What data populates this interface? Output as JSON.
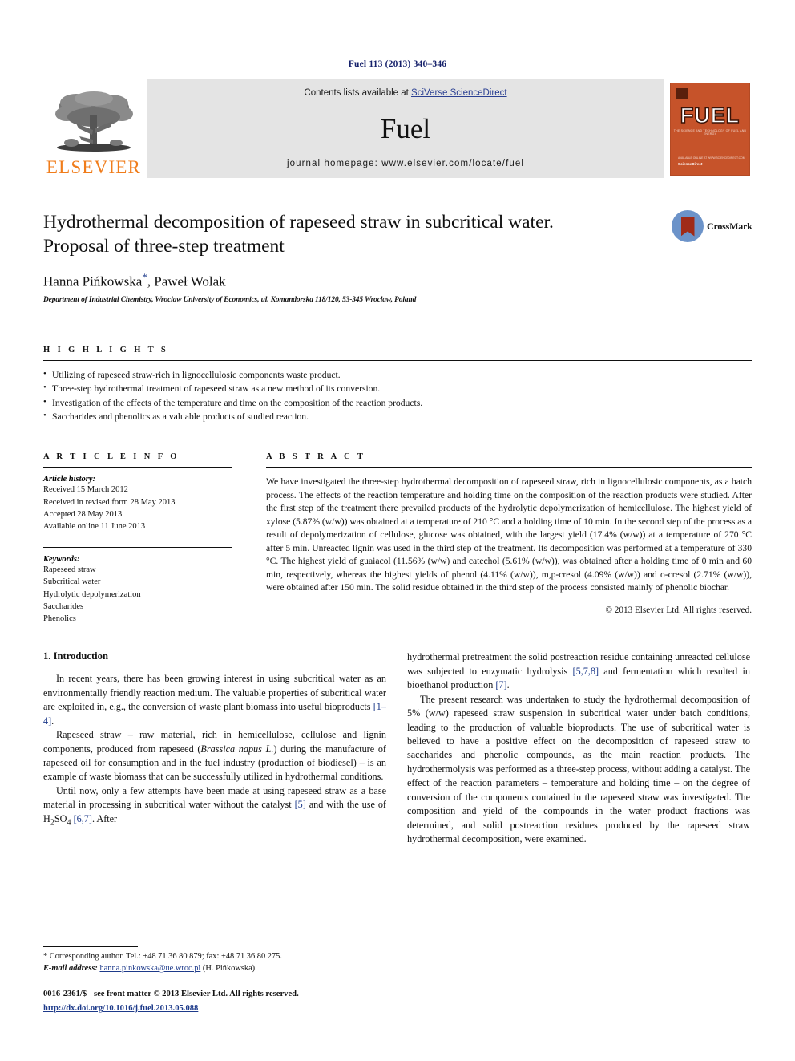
{
  "running_head": "Fuel 113 (2013) 340–346",
  "masthead": {
    "publisher_word": "ELSEVIER",
    "contents_prefix": "Contents lists available at ",
    "contents_link": "SciVerse ScienceDirect",
    "journal_name": "Fuel",
    "homepage": "journal homepage: www.elsevier.com/locate/fuel",
    "cover": {
      "title": "FUEL",
      "subtitle": "THE SCIENCE AND TECHNOLOGY OF FUEL AND ENERGY",
      "footer_small": "AVAILABLE ONLINE AT WWW.SCIENCEDIRECT.COM",
      "footer_brand": "ScienceDirect"
    }
  },
  "article": {
    "title": "Hydrothermal decomposition of rapeseed straw in subcritical water. Proposal of three-step treatment",
    "title_line1": "Hydrothermal decomposition of rapeseed straw in subcritical water.",
    "title_line2": "Proposal of three-step treatment",
    "authors": "Hanna Pińkowska",
    "corresponding_marker": "*",
    "authors_rest": ", Paweł Wolak",
    "affiliation": "Department of Industrial Chemistry, Wroclaw University of Economics, ul. Komandorska 118/120, 53-345 Wroclaw, Poland",
    "crossmark_label": "CrossMark"
  },
  "highlights": {
    "heading": "H I G H L I G H T S",
    "items": [
      "Utilizing of rapeseed straw-rich in lignocellulosic components waste product.",
      "Three-step hydrothermal treatment of rapeseed straw as a new method of its conversion.",
      "Investigation of the effects of the temperature and time on the composition of the reaction products.",
      "Saccharides and phenolics as a valuable products of studied reaction."
    ]
  },
  "article_info": {
    "heading": "A R T I C L E   I N F O",
    "history_label": "Article history:",
    "history": [
      "Received 15 March 2012",
      "Received in revised form 28 May 2013",
      "Accepted 28 May 2013",
      "Available online 11 June 2013"
    ],
    "keywords_label": "Keywords:",
    "keywords": [
      "Rapeseed straw",
      "Subcritical water",
      "Hydrolytic depolymerization",
      "Saccharides",
      "Phenolics"
    ]
  },
  "abstract": {
    "heading": "A B S T R A C T",
    "text": "We have investigated the three-step hydrothermal decomposition of rapeseed straw, rich in lignocellulosic components, as a batch process. The effects of the reaction temperature and holding time on the composition of the reaction products were studied. After the first step of the treatment there prevailed products of the hydrolytic depolymerization of hemicellulose. The highest yield of xylose (5.87% (w/w)) was obtained at a temperature of 210 °C and a holding time of 10 min. In the second step of the process as a result of depolymerization of cellulose, glucose was obtained, with the largest yield (17.4% (w/w)) at a temperature of 270 °C after 5 min. Unreacted lignin was used in the third step of the treatment. Its decomposition was performed at a temperature of 330 °C. The highest yield of guaiacol (11.56% (w/w) and catechol (5.61% (w/w)), was obtained after a holding time of 0 min and 60 min, respectively, whereas the highest yields of phenol (4.11% (w/w)), m,p-cresol (4.09% (w/w)) and o-cresol (2.71% (w/w)), were obtained after 150 min. The solid residue obtained in the third step of the process consisted mainly of phenolic biochar.",
    "copyright": "© 2013 Elsevier Ltd. All rights reserved."
  },
  "introduction": {
    "heading": "1. Introduction",
    "left_paragraphs": [
      "In recent years, there has been growing interest in using subcritical water as an environmentally friendly reaction medium. The valuable properties of subcritical water are exploited in, e.g., the conversion of waste plant biomass into useful bioproducts [1–4].",
      "Rapeseed straw – raw material, rich in hemicellulose, cellulose and lignin components, produced from rapeseed (Brassica napus L.) during the manufacture of rapeseed oil for consumption and in the fuel industry (production of biodiesel) – is an example of waste biomass that can be successfully utilized in hydrothermal conditions.",
      "Until now, only a few attempts have been made at using rapeseed straw as a base material in processing in subcritical water without the catalyst [5] and with the use of H2SO4 [6,7]. After"
    ],
    "right_paragraphs": [
      "hydrothermal pretreatment the solid postreaction residue containing unreacted cellulose was subjected to enzymatic hydrolysis [5,7,8] and fermentation which resulted in bioethanol production [7].",
      "The present research was undertaken to study the hydrothermal decomposition of 5% (w/w) rapeseed straw suspension in subcritical water under batch conditions, leading to the production of valuable bioproducts. The use of subcritical water is believed to have a positive effect on the decomposition of rapeseed straw to saccharides and phenolic compounds, as the main reaction products. The hydrothermolysis was performed as a three-step process, without adding a catalyst. The effect of the reaction parameters – temperature and holding time – on the degree of conversion of the components contained in the rapeseed straw was investigated. The composition and yield of the compounds in the water product fractions was determined, and solid postreaction residues produced by the rapeseed straw hydrothermal decomposition, were examined."
    ]
  },
  "footer": {
    "corresponding_note": "* Corresponding author. Tel.: +48 71 36 80 879; fax: +48 71 36 80 275.",
    "email_label": "E-mail address:",
    "email": "hanna.pinkowska@ue.wroc.pl",
    "email_suffix": "(H. Pińkowska).",
    "issn_line": "0016-2361/$ - see front matter © 2013 Elsevier Ltd. All rights reserved.",
    "doi_line": "http://dx.doi.org/10.1016/j.fuel.2013.05.088"
  },
  "colors": {
    "elsevier_orange": "#f07c1a",
    "link_blue": "#1d3a8a",
    "running_head_navy": "#16216b",
    "cover_orange": "#c6532a",
    "masthead_gray": "#e4e4e4",
    "crossmark_blue": "#6c93c9",
    "crossmark_red": "#a02b18"
  }
}
